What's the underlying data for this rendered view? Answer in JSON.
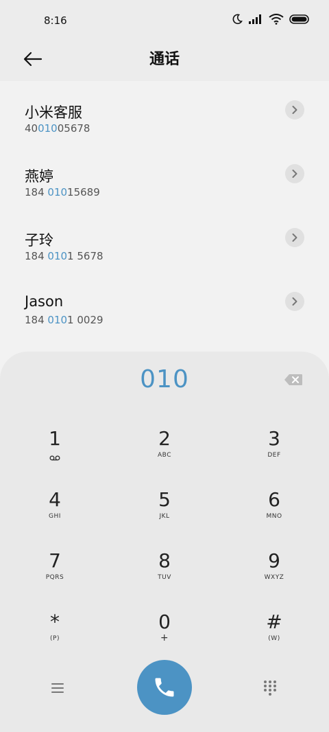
{
  "status_bar": {
    "time": "8:16",
    "icons": [
      "moon-icon",
      "signal-icon",
      "wifi-icon",
      "battery-icon"
    ]
  },
  "header": {
    "title": "通话",
    "back_icon": "arrow-left-icon"
  },
  "results": [
    {
      "name": "小米客服",
      "number_pre": "40",
      "number_match": "010",
      "number_post": "05678"
    },
    {
      "name": "燕婷",
      "number_pre": "184 ",
      "number_match": "010",
      "number_post": "15689"
    },
    {
      "name": "子玲",
      "number_pre": "184 ",
      "number_match": "010",
      "number_post": "1 5678"
    },
    {
      "name": "Jason",
      "number_pre": "184 ",
      "number_match": "010",
      "number_post": "1 0029"
    }
  ],
  "dialer": {
    "input": "010",
    "keys": [
      {
        "digit": "1",
        "letters": ""
      },
      {
        "digit": "2",
        "letters": "ABC"
      },
      {
        "digit": "3",
        "letters": "DEF"
      },
      {
        "digit": "4",
        "letters": "GHI"
      },
      {
        "digit": "5",
        "letters": "JKL"
      },
      {
        "digit": "6",
        "letters": "MNO"
      },
      {
        "digit": "7",
        "letters": "PQRS"
      },
      {
        "digit": "8",
        "letters": "TUV"
      },
      {
        "digit": "9",
        "letters": "WXYZ"
      },
      {
        "digit": "*",
        "letters": "(P)"
      },
      {
        "digit": "0",
        "letters": "+"
      },
      {
        "digit": "#",
        "letters": "(W)"
      }
    ]
  },
  "colors": {
    "accent": "#4c93c4",
    "background": "#f2f2f2",
    "panel": "#e9e9e9"
  }
}
